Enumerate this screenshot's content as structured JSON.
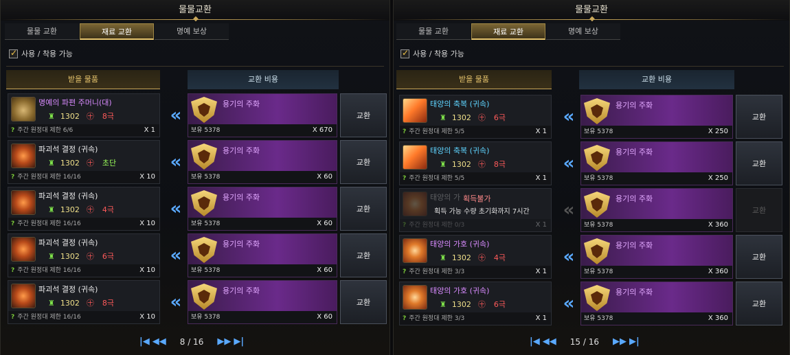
{
  "colors": {
    "accent_gold": "#e7c56d",
    "arrow_blue": "#5aa9ff",
    "cost_purple": "#6a2a8a"
  },
  "panels": [
    {
      "title": "물물교환",
      "tabs": [
        {
          "label": "물물 교환",
          "active": false
        },
        {
          "label": "재료 교환",
          "active": true
        },
        {
          "label": "명예 보상",
          "active": false
        }
      ],
      "filter_label": "사용 / 착용 가능",
      "header_receive": "받을 물품",
      "header_cost": "교환 비용",
      "rows": [
        {
          "icon": "pouch-icon",
          "name": "명예의 파편 주머니(대)",
          "name_color": "purple",
          "level": "1302",
          "grade": "8극",
          "grade_color": "red",
          "limit": "주간 원정대 제한 6/6",
          "qty": "X 1",
          "cost_name": "용기의 주화",
          "cost_own": "보유 5378",
          "cost_qty": "X 670",
          "button": "교환"
        },
        {
          "icon": "stone-icon",
          "name": "파괴석 결정 (귀속)",
          "name_color": "white",
          "level": "1302",
          "grade": "초단",
          "grade_color": "green",
          "limit": "주간 원정대 제한 16/16",
          "qty": "X 10",
          "cost_name": "용기의 주화",
          "cost_own": "보유 5378",
          "cost_qty": "X 60",
          "button": "교환"
        },
        {
          "icon": "stone-icon",
          "name": "파괴석 결정 (귀속)",
          "name_color": "white",
          "level": "1302",
          "grade": "4극",
          "grade_color": "red",
          "limit": "주간 원정대 제한 16/16",
          "qty": "X 10",
          "cost_name": "용기의 주화",
          "cost_own": "보유 5378",
          "cost_qty": "X 60",
          "button": "교환"
        },
        {
          "icon": "stone-icon",
          "name": "파괴석 결정 (귀속)",
          "name_color": "white",
          "level": "1302",
          "grade": "6극",
          "grade_color": "red",
          "limit": "주간 원정대 제한 16/16",
          "qty": "X 10",
          "cost_name": "용기의 주화",
          "cost_own": "보유 5378",
          "cost_qty": "X 60",
          "button": "교환"
        },
        {
          "icon": "stone-icon",
          "name": "파괴석 결정 (귀속)",
          "name_color": "white",
          "level": "1302",
          "grade": "8극",
          "grade_color": "red",
          "limit": "주간 원정대 제한 16/16",
          "qty": "X 10",
          "cost_name": "용기의 주화",
          "cost_own": "보유 5378",
          "cost_qty": "X 60",
          "button": "교환"
        }
      ],
      "pager": {
        "text": "8 / 16",
        "first": "|◀",
        "prev": "◀◀",
        "next": "▶▶",
        "last": "▶|"
      }
    },
    {
      "title": "물물교환",
      "tabs": [
        {
          "label": "물물 교환",
          "active": false
        },
        {
          "label": "재료 교환",
          "active": true
        },
        {
          "label": "명예 보상",
          "active": false
        }
      ],
      "filter_label": "사용 / 착용 가능",
      "header_receive": "받을 물품",
      "header_cost": "교환 비용",
      "rows": [
        {
          "icon": "crystal-icon",
          "name": "태양의 축복 (귀속)",
          "name_color": "cyan",
          "level": "1302",
          "grade": "6극",
          "grade_color": "red",
          "limit": "주간 원정대 제한 5/5",
          "qty": "X 1",
          "cost_name": "용기의 주화",
          "cost_own": "보유 5378",
          "cost_qty": "X 250",
          "button": "교환",
          "unavailable": false
        },
        {
          "icon": "crystal-icon",
          "name": "태양의 축복 (귀속)",
          "name_color": "cyan",
          "level": "1302",
          "grade": "8극",
          "grade_color": "red",
          "limit": "주간 원정대 제한 5/5",
          "qty": "X 1",
          "cost_name": "용기의 주화",
          "cost_own": "보유 5378",
          "cost_qty": "X 250",
          "button": "교환",
          "unavailable": false
        },
        {
          "icon": "guard-icon",
          "name": "태양의 가",
          "name_color": "white",
          "level": "",
          "grade": "",
          "grade_color": "red",
          "limit": "주간 원정대 제한 0/3",
          "qty": "X 1",
          "cost_name": "용기의 주화",
          "cost_own": "보유 5378",
          "cost_qty": "X 360",
          "button": "교환",
          "unavailable": true,
          "unavail_title": "획득불가",
          "unavail_sub": "획득 가능 수량 초기화까지 7시간"
        },
        {
          "icon": "guard-icon",
          "name": "태양의 가호 (귀속)",
          "name_color": "purple",
          "level": "1302",
          "grade": "4극",
          "grade_color": "red",
          "limit": "주간 원정대 제한 3/3",
          "qty": "X 1",
          "cost_name": "용기의 주화",
          "cost_own": "보유 5378",
          "cost_qty": "X 360",
          "button": "교환",
          "unavailable": false
        },
        {
          "icon": "guard-icon",
          "name": "태양의 가호 (귀속)",
          "name_color": "purple",
          "level": "1302",
          "grade": "6극",
          "grade_color": "red",
          "limit": "주간 원정대 제한 3/3",
          "qty": "X 1",
          "cost_name": "용기의 주화",
          "cost_own": "보유 5378",
          "cost_qty": "X 360",
          "button": "교환",
          "unavailable": false
        }
      ],
      "pager": {
        "text": "15 / 16",
        "first": "|◀",
        "prev": "◀◀",
        "next": "▶▶",
        "last": "▶|"
      }
    }
  ]
}
